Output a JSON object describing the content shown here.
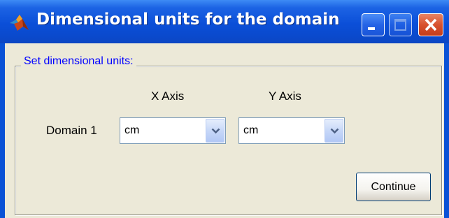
{
  "window": {
    "title": "Dimensional units for the domain",
    "controls": {
      "minimize": "minimize-icon",
      "maximize": "maximize-icon",
      "close": "close-icon"
    }
  },
  "group": {
    "label": "Set dimensional units:"
  },
  "columns": {
    "x_axis": "X Axis",
    "y_axis": "Y Axis"
  },
  "rows": [
    {
      "label": "Domain 1",
      "x_unit": "cm",
      "y_unit": "cm"
    }
  ],
  "buttons": {
    "continue": "Continue"
  },
  "colors": {
    "titlebar": "#0b4fd8",
    "client_background": "#ece9d8",
    "group_label": "#0000ff",
    "close_button": "#d8512d"
  }
}
